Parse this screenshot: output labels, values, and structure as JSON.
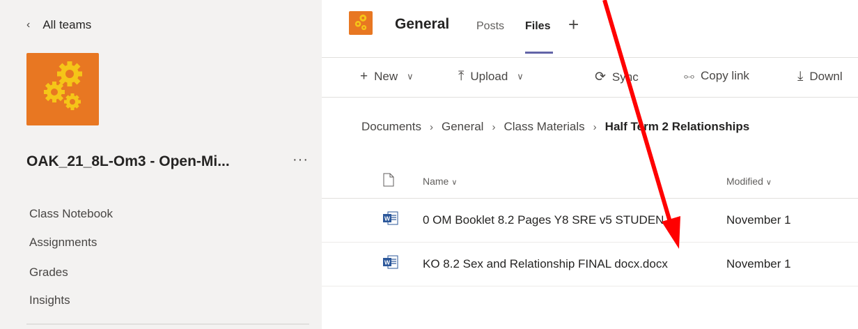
{
  "sidebar": {
    "back_label": "All teams",
    "team_name": "OAK_21_8L-Om3 - Open-Mi...",
    "more_label": "···",
    "nav_items": [
      {
        "label": "Class Notebook"
      },
      {
        "label": "Assignments"
      },
      {
        "label": "Grades"
      },
      {
        "label": "Insights"
      }
    ]
  },
  "header": {
    "channel_title": "General",
    "tabs": [
      {
        "label": "Posts",
        "active": false
      },
      {
        "label": "Files",
        "active": true
      }
    ],
    "add_tab_label": "+"
  },
  "toolbar": {
    "new_label": "New",
    "upload_label": "Upload",
    "sync_label": "Sync",
    "copy_link_label": "Copy link",
    "download_label": "Downl"
  },
  "breadcrumb": {
    "items": [
      "Documents",
      "General",
      "Class Materials"
    ],
    "current": "Half Term 2 Relationships"
  },
  "file_list": {
    "columns": {
      "name": "Name",
      "modified": "Modified"
    },
    "rows": [
      {
        "name": "0 OM Booklet 8.2 Pages Y8 SRE v5 STUDEN...",
        "modified": "November 1",
        "icon": "word-doc-icon"
      },
      {
        "name": "KO 8.2 Sex and Relationship FINAL docx.docx",
        "modified": "November 1",
        "icon": "word-doc-icon"
      }
    ]
  },
  "colors": {
    "team_orange": "#e87722",
    "gear_yellow": "#f5c518",
    "accent": "#6264a7",
    "annotation_arrow": "#ff0000",
    "word_blue": "#2b579a"
  }
}
